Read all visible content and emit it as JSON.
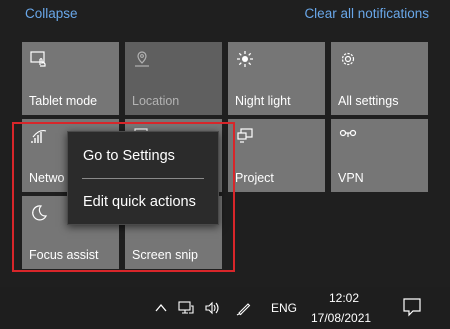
{
  "header": {
    "collapse_label": "Collapse",
    "clear_all_label": "Clear all notifications"
  },
  "tiles": [
    {
      "label": "Tablet mode",
      "icon": "tablet-mode-icon",
      "state": "off"
    },
    {
      "label": "Location",
      "icon": "location-icon",
      "state": "disabled"
    },
    {
      "label": "Night light",
      "icon": "night-light-icon",
      "state": "off"
    },
    {
      "label": "All settings",
      "icon": "settings-gear-icon",
      "state": "off"
    },
    {
      "label": "Netwo",
      "icon": "network-icon",
      "state": "off"
    },
    {
      "label": "",
      "icon": "connect-icon",
      "state": "off"
    },
    {
      "label": "Project",
      "icon": "project-icon",
      "state": "off"
    },
    {
      "label": "VPN",
      "icon": "vpn-icon",
      "state": "off"
    },
    {
      "label": "Focus assist",
      "icon": "focus-assist-moon-icon",
      "state": "off"
    },
    {
      "label": "Screen snip",
      "icon": "screen-snip-icon",
      "state": "off"
    }
  ],
  "context_menu": {
    "items": [
      {
        "label": "Go to Settings"
      },
      {
        "label": "Edit quick actions"
      }
    ]
  },
  "taskbar": {
    "language": "ENG",
    "time": "12:02",
    "date": "17/08/2021"
  },
  "colors": {
    "link": "#69a7e9",
    "tile": "#767676",
    "tile_disabled": "#5f5f5f",
    "panel": "#1f1f1f",
    "highlight": "#d8262a"
  }
}
